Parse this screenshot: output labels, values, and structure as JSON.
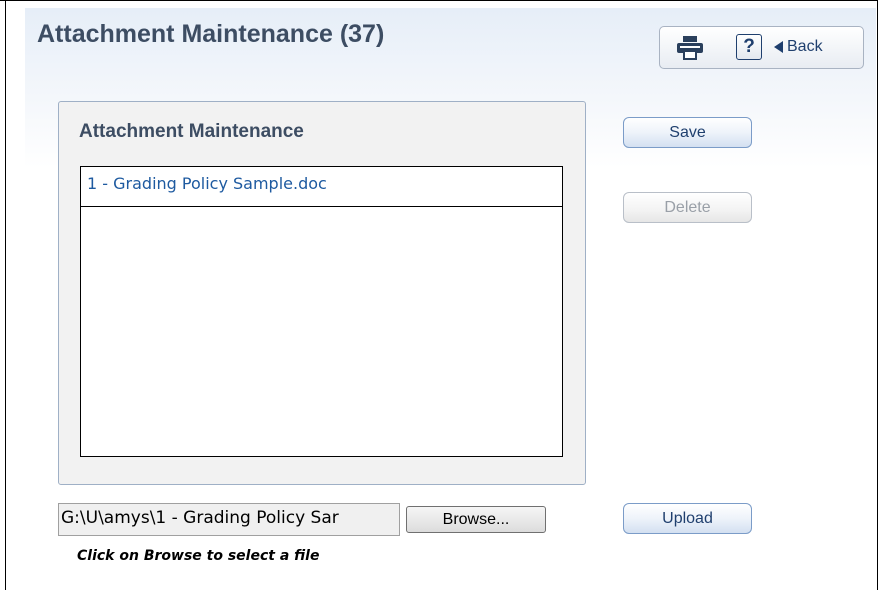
{
  "page": {
    "title": "Attachment Maintenance (37)"
  },
  "toolbar": {
    "print_icon": "printer-icon",
    "help_label": "?",
    "back_label": "Back",
    "back_icon": "left-triangle-icon"
  },
  "attachments": {
    "group_title": "Attachment Maintenance",
    "items": [
      {
        "label": "1 - Grading Policy Sample.doc"
      }
    ]
  },
  "actions": {
    "save_label": "Save",
    "delete_label": "Delete",
    "upload_label": "Upload"
  },
  "upload": {
    "file_path_value": "G:\\U\\amys\\1 - Grading Policy Sar",
    "browse_label": "Browse...",
    "hint": "Click on Browse to select a file"
  },
  "colors": {
    "title_text": "#3d4d63",
    "link_text": "#1e5aa0",
    "button_text": "#1f3f6e",
    "button_border": "#7b9cc8",
    "disabled_text": "#9aa0a8"
  }
}
